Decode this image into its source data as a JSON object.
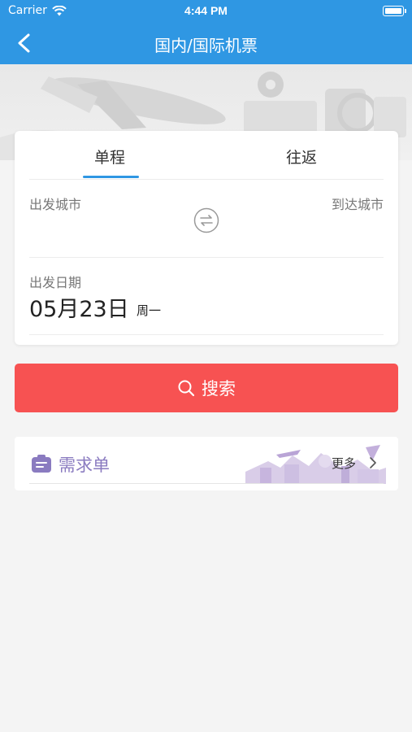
{
  "status_bar": {
    "carrier": "Carrier",
    "time": "4:44 PM"
  },
  "nav": {
    "title": "国内/国际机票",
    "back_icon": "chevron-left-icon"
  },
  "tabs": [
    {
      "label": "单程",
      "selected": true
    },
    {
      "label": "往返",
      "selected": false
    }
  ],
  "route": {
    "from_placeholder": "出发城市",
    "to_placeholder": "到达城市",
    "swap_icon": "swap-icon"
  },
  "date": {
    "label": "出发日期",
    "value": "05月23日",
    "weekday": "周一"
  },
  "search": {
    "label": "搜索",
    "icon": "search-icon"
  },
  "demand": {
    "title": "需求单",
    "more_label": "更多"
  },
  "colors": {
    "primary": "#2f97e3",
    "search": "#f75252",
    "demand_title": "#8a7bc0"
  }
}
